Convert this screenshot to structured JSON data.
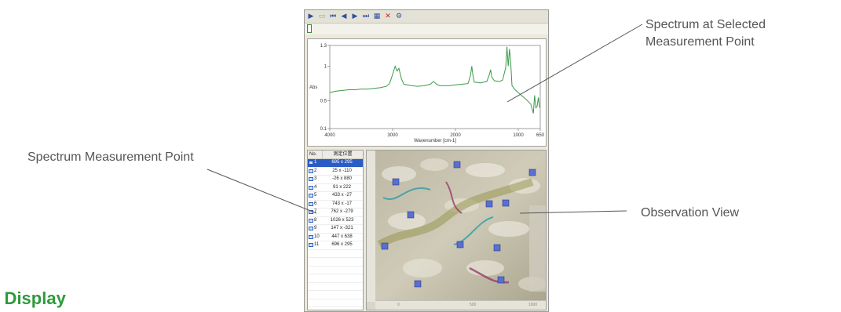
{
  "callouts": {
    "spectrum_selected": [
      "Spectrum at Selected",
      "Measurement Point"
    ],
    "measurement_point": "Spectrum Measurement Point",
    "observation_view": "Observation View"
  },
  "heading": "p Display",
  "toolbar": {
    "buttons": [
      "play-icon",
      "stop-icon",
      "first-icon",
      "prev-icon",
      "next-icon",
      "last-icon",
      "stack-icon",
      "delete-icon",
      "settings-icon"
    ]
  },
  "spectrum": {
    "y_label": "Abs",
    "x_label": "Wavenumber [cm-1]",
    "y_ticks": [
      "1.3",
      "1",
      "0.5",
      "0.1"
    ],
    "x_ticks": [
      "4000",
      "3000",
      "2000",
      "1000",
      "650"
    ],
    "line_color": "#3a9a4a"
  },
  "chart_data": {
    "type": "line",
    "xlabel": "Wavenumber [cm-1]",
    "ylabel": "Abs",
    "xlim": [
      4000,
      650
    ],
    "ylim": [
      0.1,
      1.3
    ],
    "x": [
      4000,
      3900,
      3800,
      3700,
      3600,
      3500,
      3400,
      3300,
      3200,
      3100,
      3050,
      3000,
      2960,
      2930,
      2900,
      2860,
      2820,
      2700,
      2600,
      2500,
      2400,
      2350,
      2300,
      2250,
      2100,
      2000,
      1900,
      1800,
      1760,
      1740,
      1720,
      1700,
      1600,
      1500,
      1460,
      1440,
      1420,
      1380,
      1300,
      1250,
      1200,
      1180,
      1160,
      1140,
      1120,
      1100,
      1050,
      1000,
      950,
      900,
      850,
      800,
      760,
      740,
      720,
      700,
      680,
      660
    ],
    "y": [
      0.62,
      0.64,
      0.65,
      0.66,
      0.66,
      0.67,
      0.67,
      0.68,
      0.69,
      0.71,
      0.75,
      0.88,
      1.0,
      0.93,
      0.97,
      0.82,
      0.74,
      0.72,
      0.71,
      0.72,
      0.74,
      0.78,
      0.74,
      0.72,
      0.72,
      0.73,
      0.74,
      0.75,
      0.87,
      1.0,
      0.86,
      0.77,
      0.76,
      0.78,
      0.88,
      0.95,
      0.84,
      0.79,
      0.78,
      0.8,
      0.98,
      1.28,
      1.0,
      1.25,
      1.05,
      0.72,
      0.66,
      0.62,
      0.58,
      0.54,
      0.5,
      0.45,
      0.32,
      0.58,
      0.4,
      0.42,
      0.55,
      0.4
    ]
  },
  "list": {
    "headers": [
      "No.",
      "測定位置"
    ],
    "rows": [
      {
        "no": "1",
        "pos": "695 x 295",
        "selected": true
      },
      {
        "no": "2",
        "pos": "25 x -110",
        "selected": false
      },
      {
        "no": "3",
        "pos": "-26 x 880",
        "selected": false
      },
      {
        "no": "4",
        "pos": "91 x 222",
        "selected": false
      },
      {
        "no": "5",
        "pos": "433 x -27",
        "selected": false
      },
      {
        "no": "6",
        "pos": "743 x -17",
        "selected": false
      },
      {
        "no": "7",
        "pos": "762 x -279",
        "selected": false
      },
      {
        "no": "8",
        "pos": "1026 x 523",
        "selected": false
      },
      {
        "no": "9",
        "pos": "147 x -321",
        "selected": false
      },
      {
        "no": "10",
        "pos": "447 x 638",
        "selected": false
      },
      {
        "no": "11",
        "pos": "696 x 295",
        "selected": false
      }
    ]
  },
  "observation": {
    "hruler_ticks": [
      "0",
      "500",
      "1000"
    ],
    "marker_color": "#5a6fd0"
  }
}
